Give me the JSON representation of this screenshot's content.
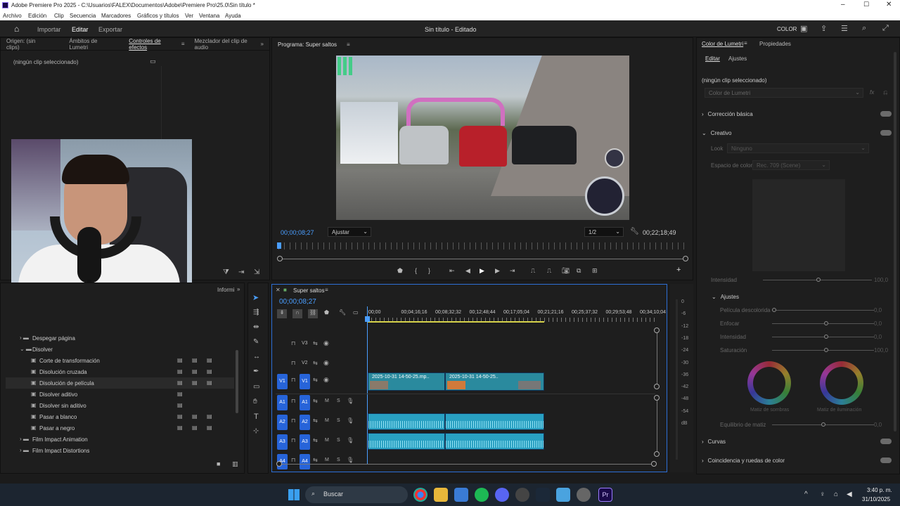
{
  "window": {
    "title": "Adobe Premiere Pro 2025 - C:\\Usuarios\\FALEX\\Documentos\\Adobe\\Premiere Pro\\25.0\\Sin título *"
  },
  "menu": [
    "Archivo",
    "Edición",
    "Clip",
    "Secuencia",
    "Marcadores",
    "Gráficos y títulos",
    "Ver",
    "Ventana",
    "Ayuda"
  ],
  "workspace": {
    "tabs": [
      "Importar",
      "Editar",
      "Exportar"
    ],
    "project": "Sin título - Editado",
    "color_label": "COLOR"
  },
  "source_panel": {
    "tabs": [
      "Origen: (sin clips)",
      "Ámbitos de Lumetri",
      "Controles de efectos",
      "Mezclador del clip de audio"
    ],
    "empty": "(ningún clip seleccionado)"
  },
  "program": {
    "title": "Programa: Super saltos",
    "timecode": "00;00;08;27",
    "fit": "Ajustar",
    "quality": "1/2",
    "duration": "00;22;18;49"
  },
  "effects": {
    "tabs": [
      "Informi"
    ],
    "items": [
      {
        "label": "Despegar página",
        "type": "folder-closed"
      },
      {
        "label": "Disolver",
        "type": "folder-open"
      },
      {
        "label": "Corte de transformación",
        "type": "fx"
      },
      {
        "label": "Disolución cruzada",
        "type": "fx"
      },
      {
        "label": "Disolución de película",
        "type": "fx"
      },
      {
        "label": "Disolver aditivo",
        "type": "fx"
      },
      {
        "label": "Disolver sin aditivo",
        "type": "fx"
      },
      {
        "label": "Pasar a blanco",
        "type": "fx"
      },
      {
        "label": "Pasar a negro",
        "type": "fx"
      },
      {
        "label": "Film Impact Animation",
        "type": "folder-closed"
      },
      {
        "label": "Film Impact Distortions",
        "type": "folder-closed"
      }
    ]
  },
  "timeline": {
    "name": "Super saltos",
    "timecode": "00;00;08;27",
    "ruler": [
      ":00;00",
      "00;04;16;16",
      "00;08;32;32",
      "00;12;48;44",
      "00;17;05;04",
      "00;21;21;16",
      "00;25;37;32",
      "00;29;53;48",
      "00;34;10;04"
    ],
    "tracks": [
      "V3",
      "V2",
      "V1",
      "A1",
      "A2",
      "A3",
      "A4"
    ],
    "clips": [
      "2025-10-31 14-50-25.mp..",
      "2025-10-31 14-50-25.."
    ],
    "meter_scale": [
      "0",
      "-6",
      "-12",
      "-18",
      "-24",
      "-30",
      "-36",
      "-42",
      "-48",
      "-54",
      "dB"
    ]
  },
  "lumetri": {
    "tabs": [
      "Color de Lumetri",
      "Propiedades"
    ],
    "subtabs": [
      "Editar",
      "Ajustes"
    ],
    "none": "(ningún clip seleccionado)",
    "dropdown": "Color de Lumetri",
    "sections": [
      "Corrección básica",
      "Creativo",
      "Curvas",
      "Coincidencia y ruedas de color"
    ],
    "look_label": "Look",
    "look_value": "Ninguno",
    "space_label": "Espacio de color",
    "space_value": "Rec. 709 (Scene)",
    "intensity": "Intensidad",
    "intensity_val": "100,0",
    "adjust": "Ajustes",
    "adj_rows": [
      {
        "label": "Película descolorida",
        "val": "0,0"
      },
      {
        "label": "Enfocar",
        "val": "0,0"
      },
      {
        "label": "Intensidad",
        "val": "0,0"
      },
      {
        "label": "Saturación",
        "val": "100,0"
      }
    ],
    "wheels": [
      "Matiz de sombras",
      "Matiz de iluminación"
    ],
    "balance": "Equilibrio de matiz",
    "balance_val": "0,0"
  },
  "taskbar": {
    "search": "Buscar",
    "time": "3:40 p. m.",
    "date": "31/10/2025"
  },
  "colors": {
    "accent": "#2764d9",
    "clip_video": "#2a8a9e",
    "clip_audio": "#29a0c2",
    "timecode": "#4a9eff"
  }
}
